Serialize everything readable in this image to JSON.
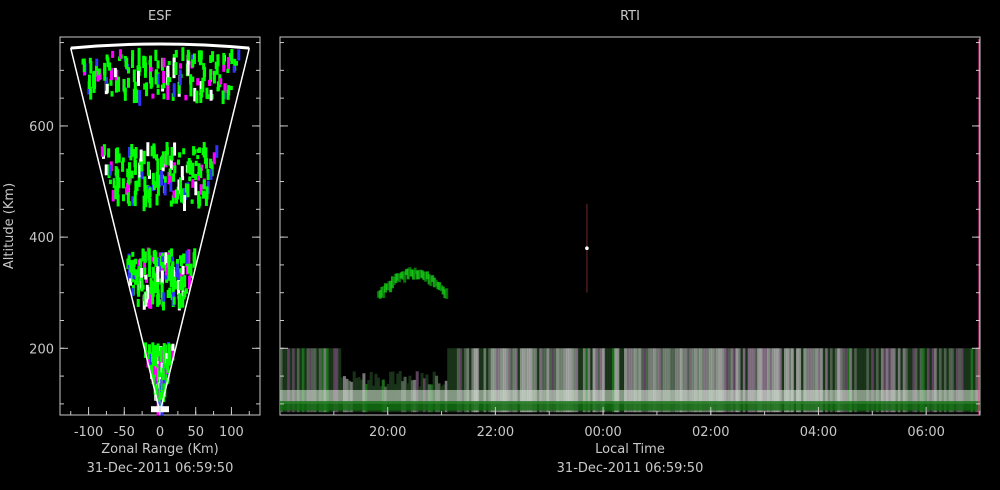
{
  "chart_data": [
    {
      "type": "scatter",
      "title": "ESF",
      "xlabel": "Zonal Range (Km)",
      "ylabel": "Altitude (Km)",
      "timestamp": "31-Dec-2011 06:59:50",
      "xlim": [
        -140,
        140
      ],
      "ylim": [
        80,
        760
      ],
      "x_ticks": [
        -100,
        -50,
        0,
        50,
        100
      ],
      "x_tick_labels": [
        "-100",
        "-50",
        "0",
        "50",
        "100"
      ],
      "y_ticks": [
        200,
        400,
        600
      ],
      "y_tick_labels": [
        "200",
        "400",
        "600"
      ],
      "fan": {
        "apex": [
          0,
          85
        ],
        "top_left": [
          -125,
          740
        ],
        "top_right": [
          125,
          740
        ]
      },
      "echo_bands": [
        {
          "alt_min": 650,
          "alt_max": 730
        },
        {
          "alt_min": 460,
          "alt_max": 560
        },
        {
          "alt_min": 280,
          "alt_max": 370
        },
        {
          "alt_min": 90,
          "alt_max": 200
        }
      ],
      "colors": [
        "#00ff00",
        "#ffffff",
        "#ff00ff",
        "#3333ff"
      ]
    },
    {
      "type": "heatmap",
      "title": "RTI",
      "xlabel": "Local Time",
      "timestamp": "31-Dec-2011 06:59:50",
      "x_ticks": [
        "20:00",
        "22:00",
        "00:00",
        "02:00",
        "04:00",
        "06:00"
      ],
      "x_tick_hours": [
        20,
        22,
        24,
        26,
        28,
        30
      ],
      "xlim_hours": [
        18.0,
        31.0
      ],
      "ylim": [
        80,
        760
      ],
      "y_ticks": [
        200,
        400,
        600
      ],
      "features": [
        {
          "name": "E-region echo",
          "t_start": 18.0,
          "t_end": 31.0,
          "alt_min": 85,
          "alt_max": 200
        },
        {
          "name": "plume",
          "t_start": 19.8,
          "t_end": 21.1,
          "alt_min": 300,
          "alt_max": 345
        },
        {
          "name": "spike",
          "t_start": 23.7,
          "t_end": 23.7,
          "alt_min": 300,
          "alt_max": 460
        }
      ],
      "colors": [
        "#00ff00",
        "#ffffff",
        "#ff88ff",
        "#33ffee"
      ]
    }
  ]
}
